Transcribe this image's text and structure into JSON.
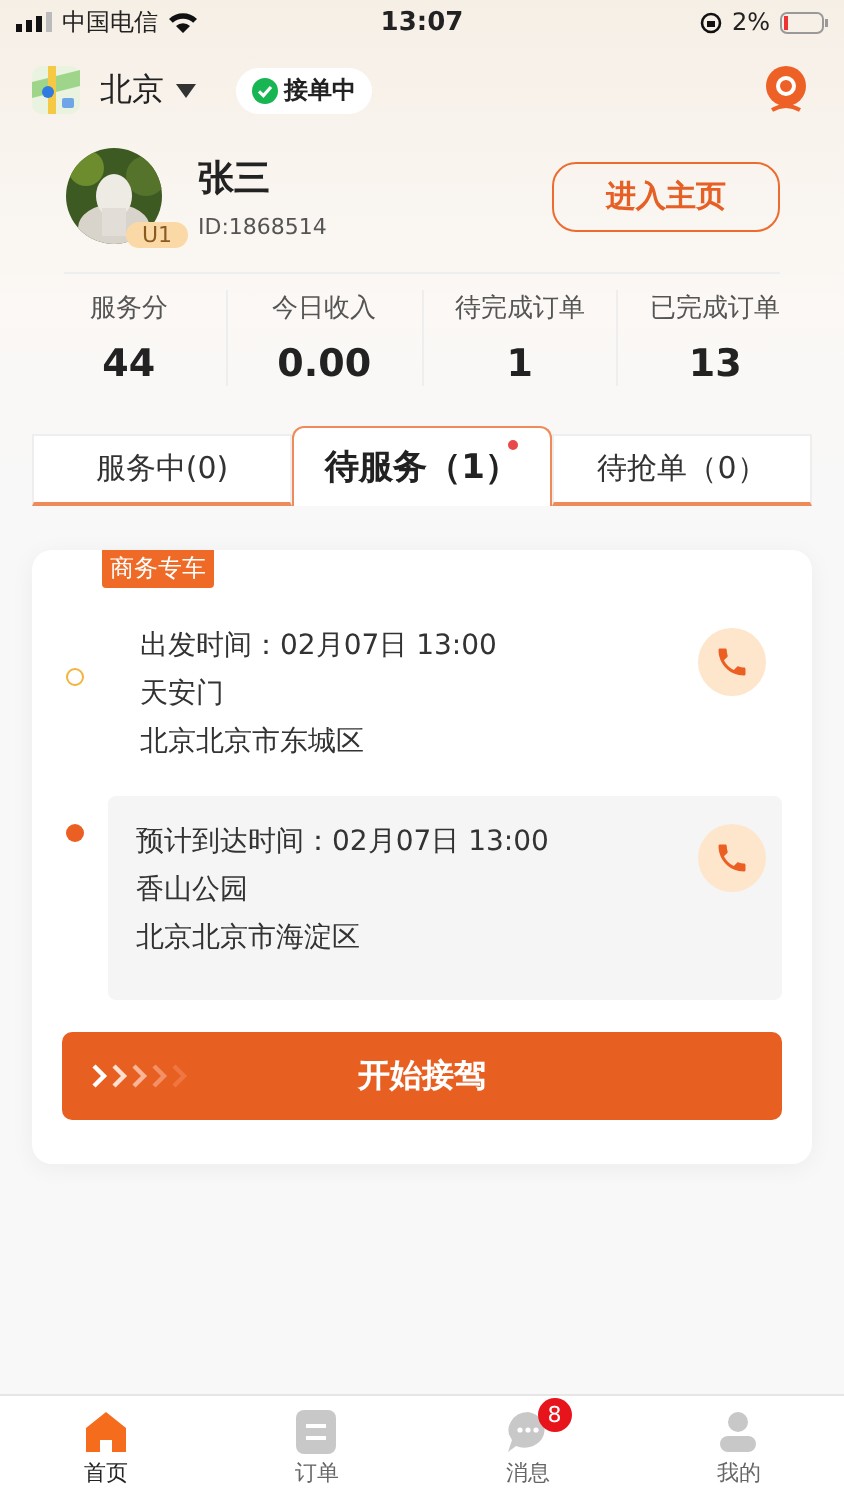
{
  "status_bar": {
    "carrier": "中国电信",
    "time": "13:07",
    "battery": "2%"
  },
  "header": {
    "city": "北京",
    "status": "接单中"
  },
  "profile": {
    "name": "张三",
    "id": "ID:1868514",
    "level": "U1",
    "home_button": "进入主页"
  },
  "stats": [
    {
      "label": "服务分",
      "value": "44"
    },
    {
      "label": "今日收入",
      "value": "0.00"
    },
    {
      "label": "待完成订单",
      "value": "1"
    },
    {
      "label": "已完成订单",
      "value": "13"
    }
  ],
  "tabs": [
    {
      "label": "服务中(0)",
      "selected": false,
      "dot": false
    },
    {
      "label": "待服务（1）",
      "selected": true,
      "dot": true
    },
    {
      "label": "待抢单（0）",
      "selected": false,
      "dot": false
    }
  ],
  "order": {
    "tag": "商务专车",
    "stops": [
      {
        "kind": "start",
        "time": "出发时间：02月07日 13:00",
        "place": "天安门",
        "address": "北京北京市东城区"
      },
      {
        "kind": "end",
        "time": "预计到达时间：02月07日 13:00",
        "place": "香山公园",
        "address": "北京北京市海淀区"
      }
    ],
    "action": "开始接驾"
  },
  "nav": [
    {
      "label": "首页",
      "selected": true
    },
    {
      "label": "订单",
      "selected": false
    },
    {
      "label": "消息",
      "selected": false,
      "badge": "8"
    },
    {
      "label": "我的",
      "selected": false
    }
  ]
}
